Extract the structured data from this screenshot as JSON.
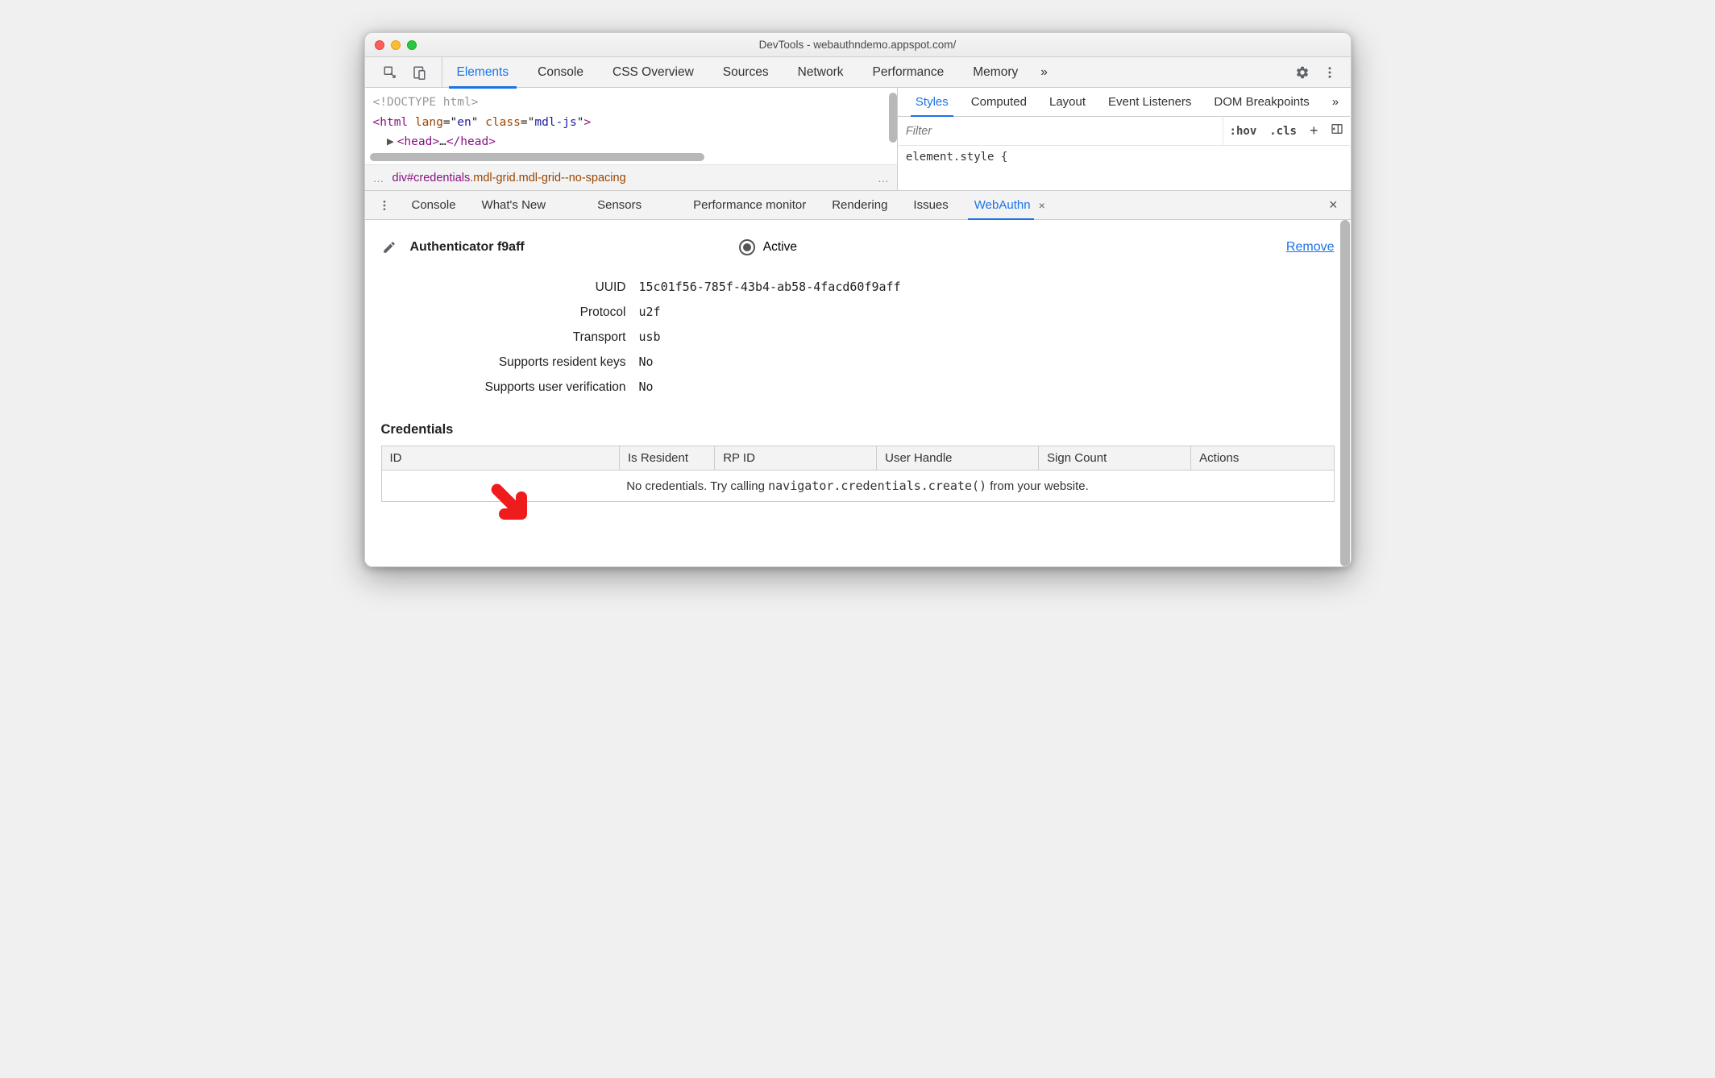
{
  "window_title": "DevTools - webauthndemo.appspot.com/",
  "main_tabs": {
    "items": [
      "Elements",
      "Console",
      "CSS Overview",
      "Sources",
      "Network",
      "Performance",
      "Memory"
    ],
    "active_index": 0,
    "overflow_glyph": "»"
  },
  "elements_pane": {
    "lines": {
      "doctype": "<!DOCTYPE html>",
      "html_open": {
        "tag": "html",
        "attrs": [
          [
            "lang",
            "en"
          ],
          [
            "class",
            "mdl-js"
          ]
        ]
      },
      "head": {
        "expand": "▶",
        "open": "<head>",
        "ellipsis": "…",
        "close": "</head>"
      }
    },
    "breadcrumb": {
      "left_ellipsis": "…",
      "tag_text": "div",
      "id_text": "#credentials",
      "class_text": ".mdl-grid.mdl-grid--no-spacing",
      "right_ellipsis": "…"
    }
  },
  "styles_pane": {
    "tabs": [
      "Styles",
      "Computed",
      "Layout",
      "Event Listeners",
      "DOM Breakpoints"
    ],
    "active_index": 0,
    "overflow_glyph": "»",
    "filter_placeholder": "Filter",
    "hov": ":hov",
    "cls": ".cls",
    "body_text": "element.style {"
  },
  "drawer": {
    "tabs": [
      "Console",
      "What's New",
      "Sensors",
      "Performance monitor",
      "Rendering",
      "Issues",
      "WebAuthn"
    ],
    "active_index": 6,
    "close_glyph": "×"
  },
  "webauthn": {
    "authenticator_title": "Authenticator f9aff",
    "active_label": "Active",
    "remove_label": "Remove",
    "props": [
      {
        "label": "UUID",
        "value": "15c01f56-785f-43b4-ab58-4facd60f9aff",
        "mono": true
      },
      {
        "label": "Protocol",
        "value": "u2f",
        "mono": true
      },
      {
        "label": "Transport",
        "value": "usb",
        "mono": true
      },
      {
        "label": "Supports resident keys",
        "value": "No",
        "mono": false
      },
      {
        "label": "Supports user verification",
        "value": "No",
        "mono": false
      }
    ],
    "credentials_heading": "Credentials",
    "cred_columns": [
      "ID",
      "Is Resident",
      "RP ID",
      "User Handle",
      "Sign Count",
      "Actions"
    ],
    "empty_prefix": "No credentials. Try calling ",
    "empty_code": "navigator.credentials.create()",
    "empty_suffix": " from your website."
  }
}
